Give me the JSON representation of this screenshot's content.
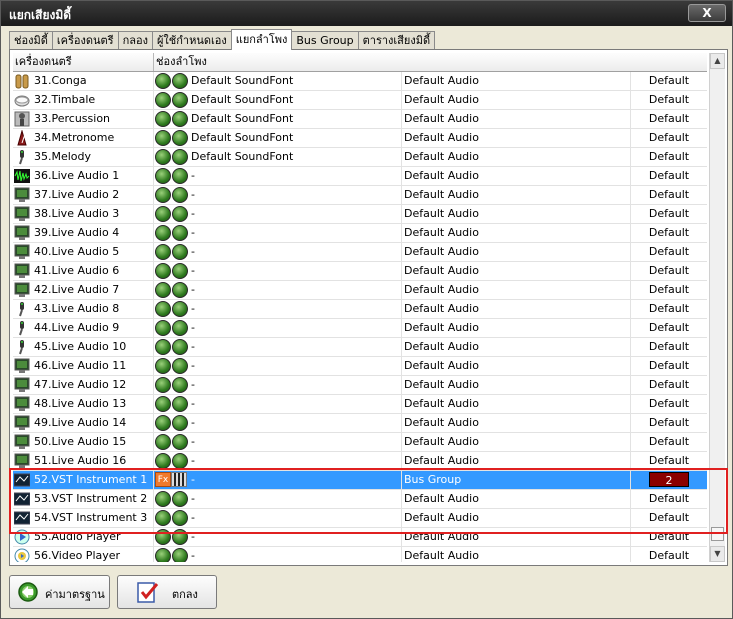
{
  "window": {
    "title": "แยกเสียงมิดี้",
    "close_label": "X"
  },
  "tabs": [
    {
      "label": "ช่องมิดี้",
      "active": false
    },
    {
      "label": "เครื่องดนตรี",
      "active": false
    },
    {
      "label": "กลอง",
      "active": false
    },
    {
      "label": "ผู้ใช้กำหนดเอง",
      "active": false
    },
    {
      "label": "แยกลำโพง",
      "active": true
    },
    {
      "label": "Bus Group",
      "active": false
    },
    {
      "label": "ตารางเสียงมิดี้",
      "active": false
    }
  ],
  "table": {
    "headers": {
      "instrument": "เครื่องดนตรี",
      "channel": "ช่องลำโพง"
    },
    "rows": [
      {
        "name": "31.Conga",
        "icon": "conga-icon",
        "output": "Default SoundFont",
        "bus": "Default Audio",
        "def": "Default"
      },
      {
        "name": "32.Timbale",
        "icon": "timbale-icon",
        "output": "Default SoundFont",
        "bus": "Default Audio",
        "def": "Default"
      },
      {
        "name": "33.Percussion",
        "icon": "percussion-icon",
        "output": "Default SoundFont",
        "bus": "Default Audio",
        "def": "Default"
      },
      {
        "name": "34.Metronome",
        "icon": "metronome-icon",
        "output": "Default SoundFont",
        "bus": "Default Audio",
        "def": "Default"
      },
      {
        "name": "35.Melody",
        "icon": "microphone-icon",
        "output": "Default SoundFont",
        "bus": "Default Audio",
        "def": "Default"
      },
      {
        "name": "36.Live Audio 1",
        "icon": "waveform-icon",
        "output": "-",
        "bus": "Default Audio",
        "def": "Default"
      },
      {
        "name": "37.Live Audio 2",
        "icon": "monitor-icon",
        "output": "-",
        "bus": "Default Audio",
        "def": "Default"
      },
      {
        "name": "38.Live Audio 3",
        "icon": "monitor-icon",
        "output": "-",
        "bus": "Default Audio",
        "def": "Default"
      },
      {
        "name": "39.Live Audio 4",
        "icon": "monitor-icon",
        "output": "-",
        "bus": "Default Audio",
        "def": "Default"
      },
      {
        "name": "40.Live Audio 5",
        "icon": "monitor-icon",
        "output": "-",
        "bus": "Default Audio",
        "def": "Default"
      },
      {
        "name": "41.Live Audio 6",
        "icon": "monitor-icon",
        "output": "-",
        "bus": "Default Audio",
        "def": "Default"
      },
      {
        "name": "42.Live Audio 7",
        "icon": "monitor-icon",
        "output": "-",
        "bus": "Default Audio",
        "def": "Default"
      },
      {
        "name": "43.Live Audio 8",
        "icon": "microphone-icon",
        "output": "-",
        "bus": "Default Audio",
        "def": "Default"
      },
      {
        "name": "44.Live Audio 9",
        "icon": "microphone-icon",
        "output": "-",
        "bus": "Default Audio",
        "def": "Default"
      },
      {
        "name": "45.Live Audio 10",
        "icon": "microphone-icon",
        "output": "-",
        "bus": "Default Audio",
        "def": "Default"
      },
      {
        "name": "46.Live Audio 11",
        "icon": "monitor-icon",
        "output": "-",
        "bus": "Default Audio",
        "def": "Default"
      },
      {
        "name": "47.Live Audio 12",
        "icon": "monitor-icon",
        "output": "-",
        "bus": "Default Audio",
        "def": "Default"
      },
      {
        "name": "48.Live Audio 13",
        "icon": "monitor-icon",
        "output": "-",
        "bus": "Default Audio",
        "def": "Default"
      },
      {
        "name": "49.Live Audio 14",
        "icon": "monitor-icon",
        "output": "-",
        "bus": "Default Audio",
        "def": "Default"
      },
      {
        "name": "50.Live Audio 15",
        "icon": "monitor-icon",
        "output": "-",
        "bus": "Default Audio",
        "def": "Default"
      },
      {
        "name": "51.Live Audio 16",
        "icon": "monitor-icon",
        "output": "-",
        "bus": "Default Audio",
        "def": "Default"
      },
      {
        "name": "52.VST Instrument 1",
        "icon": "vst-icon",
        "output": "-",
        "bus": "Bus Group",
        "def": "2",
        "selected": true,
        "fx": "Fx"
      },
      {
        "name": "53.VST Instrument 2",
        "icon": "vst-icon",
        "output": "-",
        "bus": "Default Audio",
        "def": "Default"
      },
      {
        "name": "54.VST Instrument 3",
        "icon": "vst-icon",
        "output": "-",
        "bus": "Default Audio",
        "def": "Default"
      },
      {
        "name": "55.Audio Player",
        "icon": "audio-player-icon",
        "output": "-",
        "bus": "Default Audio",
        "def": "Default"
      },
      {
        "name": "56.Video Player",
        "icon": "video-player-icon",
        "output": "-",
        "bus": "Default Audio",
        "def": "Default"
      }
    ]
  },
  "colors": {
    "selection": "#3399ff",
    "highlight": "#e02020",
    "bus_badge": "#8b0000",
    "led": "#2e7a1e"
  },
  "footer": {
    "default_label": "ค่ามาตรฐาน",
    "ok_label": "ตกลง"
  }
}
